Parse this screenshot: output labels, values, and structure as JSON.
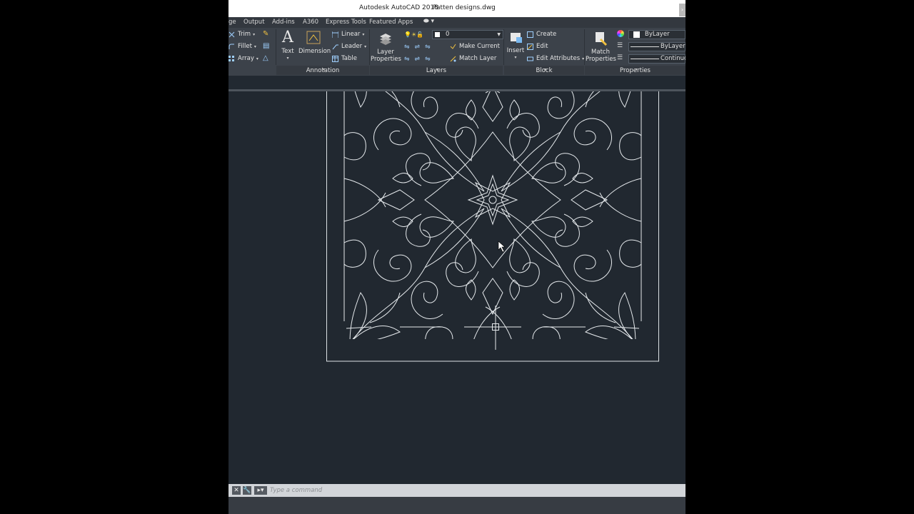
{
  "window": {
    "app_title": "Autodesk AutoCAD 2018",
    "file_name": "Patten designs.dwg"
  },
  "tabs": [
    "ge",
    "Output",
    "Add-ins",
    "A360",
    "Express Tools",
    "Featured Apps"
  ],
  "ribbon": {
    "modify": {
      "trim": "Trim",
      "fillet": "Fillet",
      "array": "Array"
    },
    "annotation": {
      "text": "Text",
      "dimension": "Dimension",
      "linear": "Linear",
      "leader": "Leader",
      "table": "Table",
      "panel_label": "Annotation"
    },
    "layers": {
      "layer_properties": "Layer Properties",
      "current_layer": "0",
      "make_current": "Make Current",
      "match_layer": "Match Layer",
      "panel_label": "Layers"
    },
    "block": {
      "insert": "Insert",
      "create": "Create",
      "edit": "Edit",
      "edit_attributes": "Edit Attributes",
      "panel_label": "Block"
    },
    "properties": {
      "match_properties": "Match Properties",
      "color": "ByLayer",
      "lineweight": "ByLayer",
      "linetype": "Continuo",
      "panel_label": "Properties"
    }
  },
  "command_line": {
    "placeholder": "Type a command"
  },
  "colors": {
    "canvas_bg": "#212830",
    "ribbon_bg": "#3c424a",
    "line_color": "#e8ecef"
  }
}
